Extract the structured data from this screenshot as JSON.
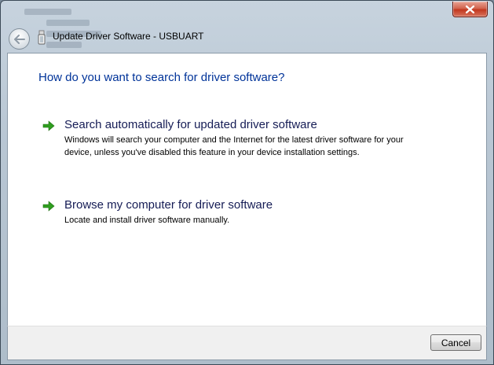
{
  "window": {
    "title": "Update Driver Software - USBUART"
  },
  "heading": "How do you want to search for driver software?",
  "options": [
    {
      "title": "Search automatically for updated driver software",
      "description": "Windows will search your computer and the Internet for the latest driver software for your device, unless you've disabled this feature in your device installation settings."
    },
    {
      "title": "Browse my computer for driver software",
      "description": "Locate and install driver software manually."
    }
  ],
  "footer": {
    "cancel_label": "Cancel"
  },
  "colors": {
    "heading": "#003399",
    "option_title": "#151c55",
    "arrow": "#2f9e1f"
  },
  "icons": {
    "back": "back-arrow-icon",
    "device": "usb-device-icon",
    "option_arrow": "green-arrow-icon",
    "close": "close-icon"
  }
}
